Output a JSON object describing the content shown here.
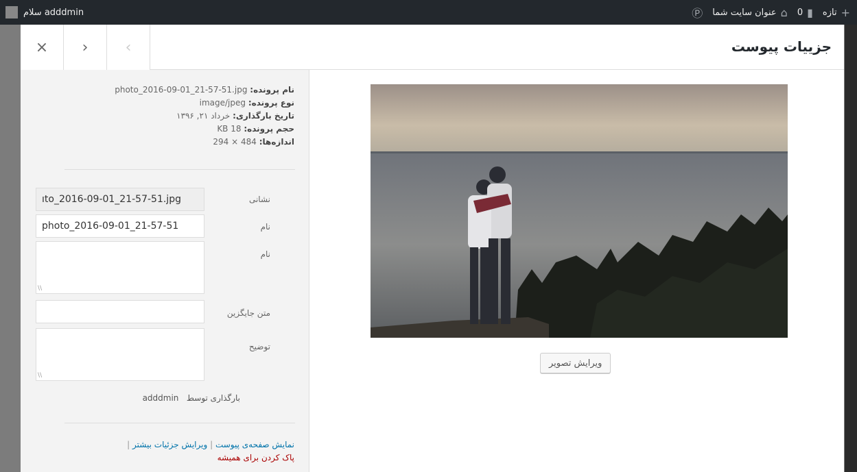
{
  "adminbar": {
    "site_title": "عنوان سایت شما",
    "comments_count": "0",
    "new_label": "تازه",
    "greeting": "سلام adddmin"
  },
  "modal": {
    "title": "جزییات پیوست",
    "close_label": "×",
    "next_label": "›",
    "prev_label": "‹"
  },
  "media": {
    "edit_image_button": "ویرایش تصویر"
  },
  "file_info": {
    "file_name_label": "نام پرونده:",
    "file_name": "photo_2016-09-01_21-57-51.jpg",
    "file_type_label": "نوع پرونده:",
    "file_type": "image/jpeg",
    "upload_date_label": "تاریخ بارگذاری:",
    "upload_date": "خرداد ۲۱, ۱۳۹۶",
    "file_size_label": "حجم پرونده:",
    "file_size": "18 KB",
    "dimensions_label": "اندازه‌ها:",
    "dimensions": "484 × 294"
  },
  "fields": {
    "url_label": "نشانی",
    "url_value": "ıto_2016-09-01_21-57-51.jpg",
    "title_label": "نام",
    "title_value": "photo_2016-09-01_21-57-51",
    "caption_label": "نام",
    "caption_value": "",
    "alt_label": "متن جایگزین",
    "alt_value": "",
    "description_label": "توضیح",
    "description_value": ""
  },
  "uploaded_by": {
    "label": "بارگذاری توسط",
    "user": "adddmin"
  },
  "actions": {
    "view_attachment": "نمایش صفحه‌ی پیوست",
    "separator": "|",
    "edit_more": "ویرایش جزئیات بیشتر",
    "delete_permanently": "پاک کردن برای همیشه"
  },
  "colors": {
    "adminbar_bg": "#23282d",
    "link": "#0073aa",
    "danger": "#a00000"
  }
}
